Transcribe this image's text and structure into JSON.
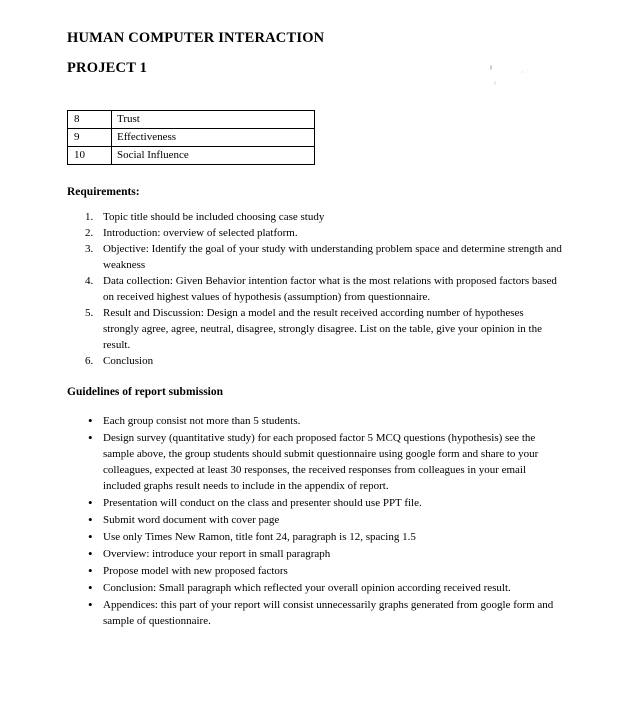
{
  "document": {
    "title_line1": "HUMAN COMPUTER INTERACTION",
    "title_line2": "PROJECT 1"
  },
  "factors_table": {
    "rows": [
      {
        "number": "8",
        "factor": "Trust"
      },
      {
        "number": "9",
        "factor": "Effectiveness"
      },
      {
        "number": "10",
        "factor": "Social Influence"
      }
    ]
  },
  "requirements": {
    "heading": "Requirements:",
    "items": [
      {
        "marker": "1.",
        "text": "Topic title should be included choosing case study"
      },
      {
        "marker": "2.",
        "text": "Introduction: overview of selected platform."
      },
      {
        "marker": "3.",
        "text": "Objective: Identify the goal of your study with  understanding problem space and determine strength and weakness"
      },
      {
        "marker": "4.",
        "text": "Data collection: Given Behavior intention factor what is the most relations with proposed factors based on received highest values of hypothesis (assumption) from questionnaire."
      },
      {
        "marker": "5.",
        "text": "Result and Discussion: Design a model and the result received according number of hypotheses strongly agree, agree, neutral, disagree, strongly disagree. List on the table, give your opinion in the result."
      },
      {
        "marker": "6.",
        "text": "Conclusion"
      }
    ]
  },
  "guidelines": {
    "heading": "Guidelines of report submission",
    "items": [
      {
        "marker": "•",
        "text": "Each group consist not more than 5 students."
      },
      {
        "marker": "•",
        "text": "Design survey (quantitative study) for each proposed factor 5 MCQ questions (hypothesis) see the sample above, the group students should submit questionnaire using google form and share to your colleagues, expected at least 30 responses, the received responses from colleagues in your email included graphs result needs to include in the appendix of report."
      },
      {
        "marker": "•",
        "text": "Presentation will conduct on the class and presenter should use PPT file."
      },
      {
        "marker": "•",
        "text": "Submit word document with cover page"
      },
      {
        "marker": "•",
        "text": "Use only Times New Ramon, title font 24, paragraph is 12, spacing 1.5"
      },
      {
        "marker": "•",
        "text": "Overview: introduce your report in small paragraph"
      },
      {
        "marker": "•",
        "text": "Propose model with new proposed factors"
      },
      {
        "marker": "•",
        "text": "Conclusion: Small paragraph which reflected your overall opinion according received result."
      },
      {
        "marker": "•",
        "text": "Appendices: this part of your report will consist unnecessarily graphs generated from google form and sample of questionnaire."
      }
    ]
  },
  "colors": {
    "page_background": "#ffffff",
    "text": "#000000",
    "table_border": "#000000",
    "speckle": "#a8c4e0"
  }
}
